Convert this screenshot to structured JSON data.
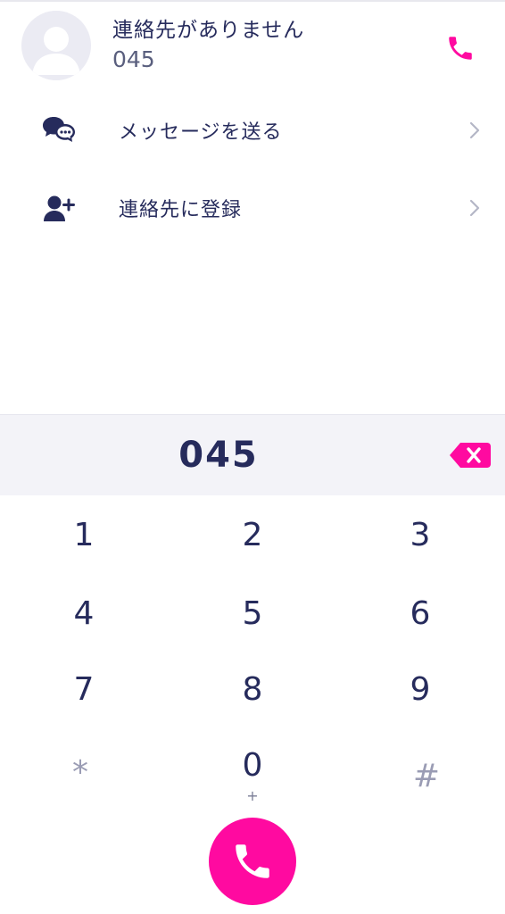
{
  "contact": {
    "name": "連絡先がありません",
    "number": "045"
  },
  "actions": [
    {
      "label": "メッセージを送る",
      "icon": "chat-bubbles-icon"
    },
    {
      "label": "連絡先に登録",
      "icon": "add-contact-icon"
    }
  ],
  "dialer": {
    "display": "045",
    "keys": [
      {
        "digit": "1",
        "sub": ""
      },
      {
        "digit": "2",
        "sub": ""
      },
      {
        "digit": "3",
        "sub": ""
      },
      {
        "digit": "4",
        "sub": ""
      },
      {
        "digit": "5",
        "sub": ""
      },
      {
        "digit": "6",
        "sub": ""
      },
      {
        "digit": "7",
        "sub": ""
      },
      {
        "digit": "8",
        "sub": ""
      },
      {
        "digit": "9",
        "sub": ""
      },
      {
        "digit": "*",
        "sub": ""
      },
      {
        "digit": "0",
        "sub": "+"
      },
      {
        "digit": "#",
        "sub": ""
      }
    ]
  },
  "colors": {
    "accent": "#ff0aa0",
    "text": "#262b5c",
    "display_bg": "#f3f3f8"
  }
}
